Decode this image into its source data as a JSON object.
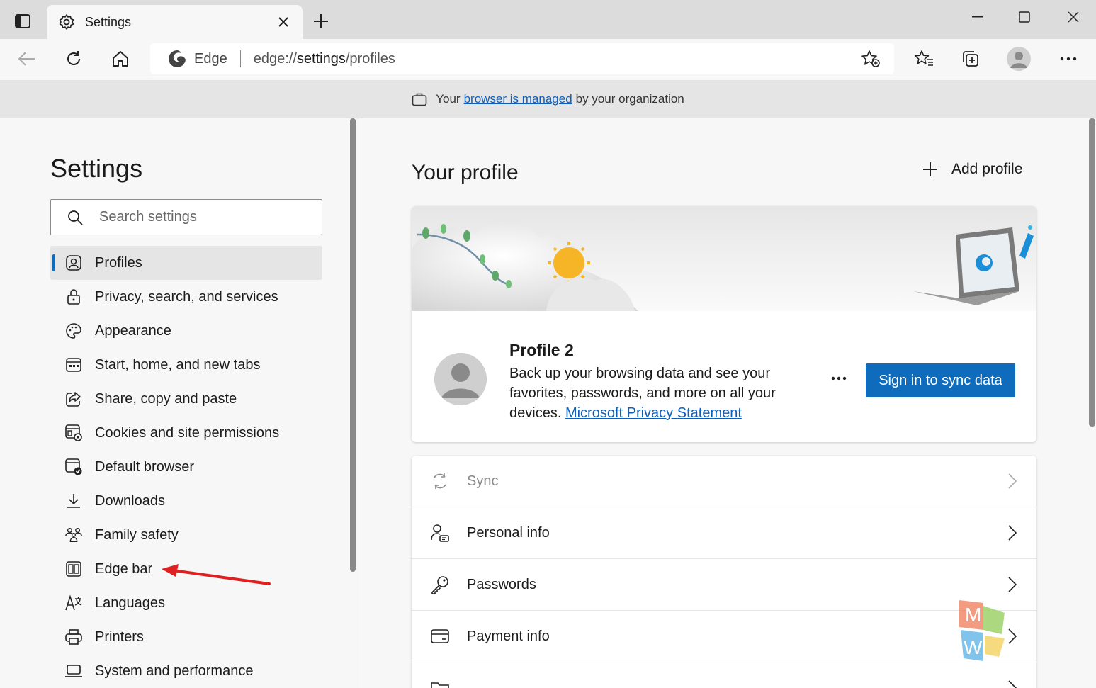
{
  "tab": {
    "title": "Settings"
  },
  "address": {
    "edge_label": "Edge",
    "url_host": "edge://",
    "url_path": "settings",
    "url_tail": "/profiles"
  },
  "banner": {
    "prefix": "Your",
    "link": "browser is managed",
    "suffix": "by your organization"
  },
  "sidebar": {
    "title": "Settings",
    "search_placeholder": "Search settings",
    "items": [
      {
        "label": "Profiles",
        "icon": "profile-icon"
      },
      {
        "label": "Privacy, search, and services",
        "icon": "lock-icon"
      },
      {
        "label": "Appearance",
        "icon": "palette-icon"
      },
      {
        "label": "Start, home, and new tabs",
        "icon": "start-page-icon"
      },
      {
        "label": "Share, copy and paste",
        "icon": "share-icon"
      },
      {
        "label": "Cookies and site permissions",
        "icon": "cookies-icon"
      },
      {
        "label": "Default browser",
        "icon": "default-browser-icon"
      },
      {
        "label": "Downloads",
        "icon": "download-icon"
      },
      {
        "label": "Family safety",
        "icon": "family-icon"
      },
      {
        "label": "Edge bar",
        "icon": "edge-bar-icon"
      },
      {
        "label": "Languages",
        "icon": "languages-icon"
      },
      {
        "label": "Printers",
        "icon": "printer-icon"
      },
      {
        "label": "System and performance",
        "icon": "laptop-icon"
      }
    ]
  },
  "main": {
    "heading": "Your profile",
    "add_profile": "Add profile",
    "profile": {
      "name": "Profile 2",
      "desc": "Back up your browsing data and see your favorites, passwords, and more on all your devices.",
      "privacy_link": "Microsoft Privacy Statement",
      "sync_button": "Sign in to sync data"
    },
    "rows": [
      {
        "label": "Sync",
        "icon": "sync-icon"
      },
      {
        "label": "Personal info",
        "icon": "person-card-icon"
      },
      {
        "label": "Passwords",
        "icon": "key-icon"
      },
      {
        "label": "Payment info",
        "icon": "credit-card-icon"
      }
    ]
  },
  "colors": {
    "accent": "#0f6cbd",
    "link": "#0f5fb8",
    "annotation_arrow": "#e02020"
  }
}
